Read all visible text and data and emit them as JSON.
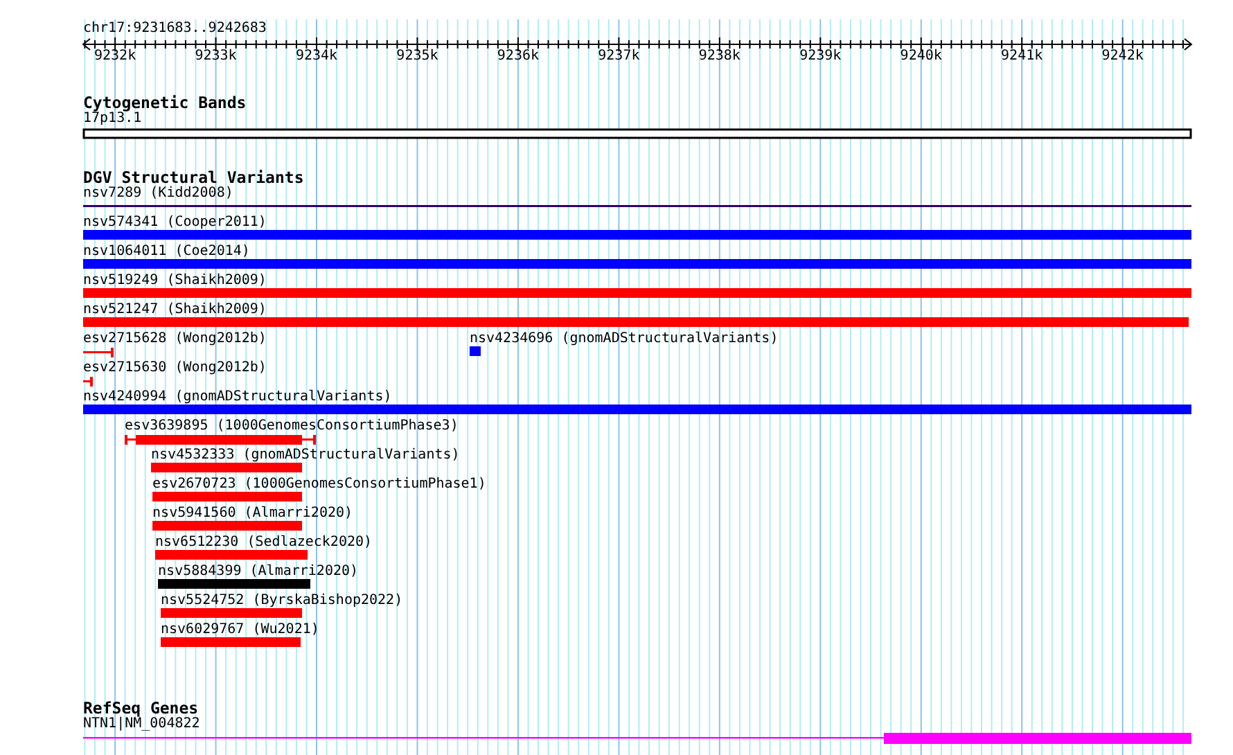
{
  "region": {
    "label": "chr17:9231683..9242683"
  },
  "ruler": {
    "ticks": [
      {
        "label": "9232k"
      },
      {
        "label": "9233k"
      },
      {
        "label": "9234k"
      },
      {
        "label": "9235k"
      },
      {
        "label": "9236k"
      },
      {
        "label": "9237k"
      },
      {
        "label": "9238k"
      },
      {
        "label": "9239k"
      },
      {
        "label": "9240k"
      },
      {
        "label": "9241k"
      },
      {
        "label": "9242k"
      }
    ]
  },
  "tracks": [
    {
      "kind": "bands",
      "title": "Cytogenetic Bands",
      "features": [
        {
          "label": "17p13.1"
        }
      ]
    },
    {
      "kind": "variants",
      "title": "DGV Structural Variants",
      "rows": [
        {
          "features": [
            {
              "label": "nsv7289 (Kidd2008)",
              "kind": "thin",
              "color": "#330066"
            }
          ]
        },
        {
          "features": [
            {
              "label": "nsv574341 (Cooper2011)",
              "kind": "bar",
              "color": "#0000ff"
            }
          ]
        },
        {
          "features": [
            {
              "label": "nsv1064011 (Coe2014)",
              "kind": "bar",
              "color": "#0000ff"
            }
          ]
        },
        {
          "features": [
            {
              "label": "nsv519249 (Shaikh2009)",
              "kind": "bar",
              "color": "#ff0000"
            }
          ]
        },
        {
          "features": [
            {
              "label": "nsv521247 (Shaikh2009)",
              "kind": "bar",
              "color": "#ff0000"
            }
          ]
        },
        {
          "features": [
            {
              "label": "esv2715628 (Wong2012b)",
              "kind": "whisker",
              "color": "#ff0000"
            },
            {
              "label": "nsv4234696 (gnomADStructuralVariants)",
              "kind": "bar",
              "color": "#0000ff"
            }
          ]
        },
        {
          "features": [
            {
              "label": "esv2715630 (Wong2012b)",
              "kind": "whisker",
              "color": "#ff0000"
            }
          ]
        },
        {
          "features": [
            {
              "label": "nsv4240994 (gnomADStructuralVariants)",
              "kind": "bar",
              "color": "#0000ff"
            }
          ]
        },
        {
          "features": [
            {
              "label": "esv3639895 (1000GenomesConsortiumPhase3)",
              "kind": "whisker",
              "color": "#ff0000"
            }
          ]
        },
        {
          "features": [
            {
              "label": "nsv4532333 (gnomADStructuralVariants)",
              "kind": "bar",
              "color": "#ff0000"
            }
          ]
        },
        {
          "features": [
            {
              "label": "esv2670723 (1000GenomesConsortiumPhase1)",
              "kind": "bar",
              "color": "#ff0000"
            }
          ]
        },
        {
          "features": [
            {
              "label": "nsv5941560 (Almarri2020)",
              "kind": "bar",
              "color": "#ff0000"
            }
          ]
        },
        {
          "features": [
            {
              "label": "nsv6512230 (Sedlazeck2020)",
              "kind": "bar",
              "color": "#ff0000"
            }
          ]
        },
        {
          "features": [
            {
              "label": "nsv5884399 (Almarri2020)",
              "kind": "bar",
              "color": "#000000"
            }
          ]
        },
        {
          "features": [
            {
              "label": "nsv5524752 (ByrskaBishop2022)",
              "kind": "bar",
              "color": "#ff0000"
            }
          ]
        },
        {
          "features": [
            {
              "label": "nsv6029767 (Wu2021)",
              "kind": "bar",
              "color": "#ff0000"
            }
          ]
        }
      ]
    },
    {
      "kind": "genes",
      "title": "RefSeq Genes",
      "features": [
        {
          "label": "NTN1|NM_004822"
        }
      ]
    }
  ]
}
